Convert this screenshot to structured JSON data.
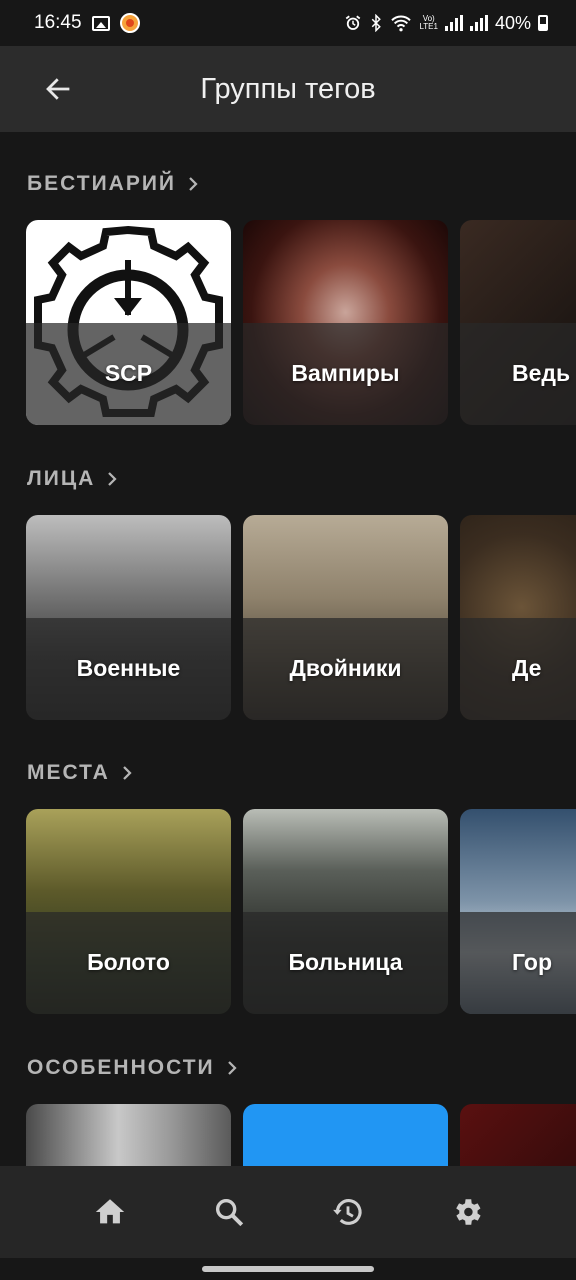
{
  "status_bar": {
    "time": "16:45",
    "network": "Vo)\nLTE1",
    "battery": "40%"
  },
  "app_bar": {
    "title": "Группы тегов",
    "back_icon": "arrow-back-icon"
  },
  "sections": [
    {
      "title": "БЕСТИАРИЙ",
      "cards": [
        {
          "label": "SCP",
          "image": "scp-logo"
        },
        {
          "label": "Вампиры",
          "image": "vampire-photo"
        },
        {
          "label": "Ведь",
          "image": "witch-photo"
        }
      ]
    },
    {
      "title": "ЛИЦА",
      "cards": [
        {
          "label": "Военные",
          "image": "battlefield-photo"
        },
        {
          "label": "Двойники",
          "image": "twins-photo"
        },
        {
          "label": "Де",
          "image": "doll-eye-photo"
        }
      ]
    },
    {
      "title": "МЕСТА",
      "cards": [
        {
          "label": "Болото",
          "image": "forest-swamp-photo"
        },
        {
          "label": "Больница",
          "image": "hospital-room-photo"
        },
        {
          "label": "Гор",
          "image": "mountains-photo"
        }
      ]
    },
    {
      "title": "ОСОБЕННОСТИ",
      "cards": [
        {
          "label": "",
          "image": "archive-shelves-photo"
        },
        {
          "label": "",
          "image": "blue-placeholder"
        },
        {
          "label": "",
          "image": "dark-red-photo"
        }
      ]
    }
  ],
  "bottom_nav": [
    {
      "icon": "home-icon"
    },
    {
      "icon": "search-icon"
    },
    {
      "icon": "history-icon"
    },
    {
      "icon": "settings-icon"
    }
  ],
  "colors": {
    "background": "#171717",
    "app_bar": "#2c2c2c",
    "bottom_nav": "#262626",
    "section_title": "#b5b5b5",
    "blue_card": "#2196f3"
  }
}
